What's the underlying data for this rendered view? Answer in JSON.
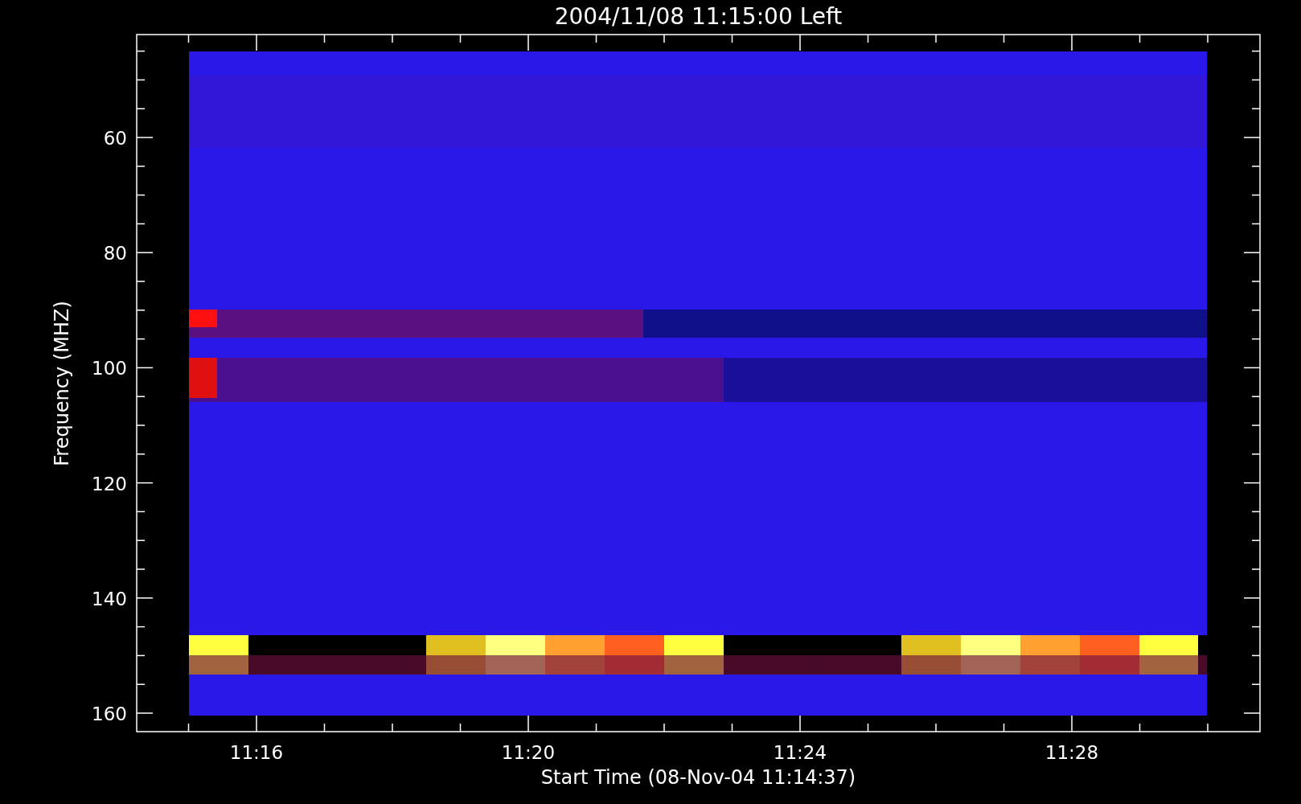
{
  "plot": {
    "title": "2004/11/08 11:15:00 Left",
    "x_axis": {
      "label": "Start Time (08-Nov-04 11:14:37)",
      "ticks": [
        "11:16",
        "11:20",
        "11:24",
        "11:28"
      ]
    },
    "y_axis": {
      "label": "Frequency (MHZ)",
      "ticks": [
        "60",
        "80",
        "100",
        "120",
        "140",
        "160"
      ]
    }
  }
}
